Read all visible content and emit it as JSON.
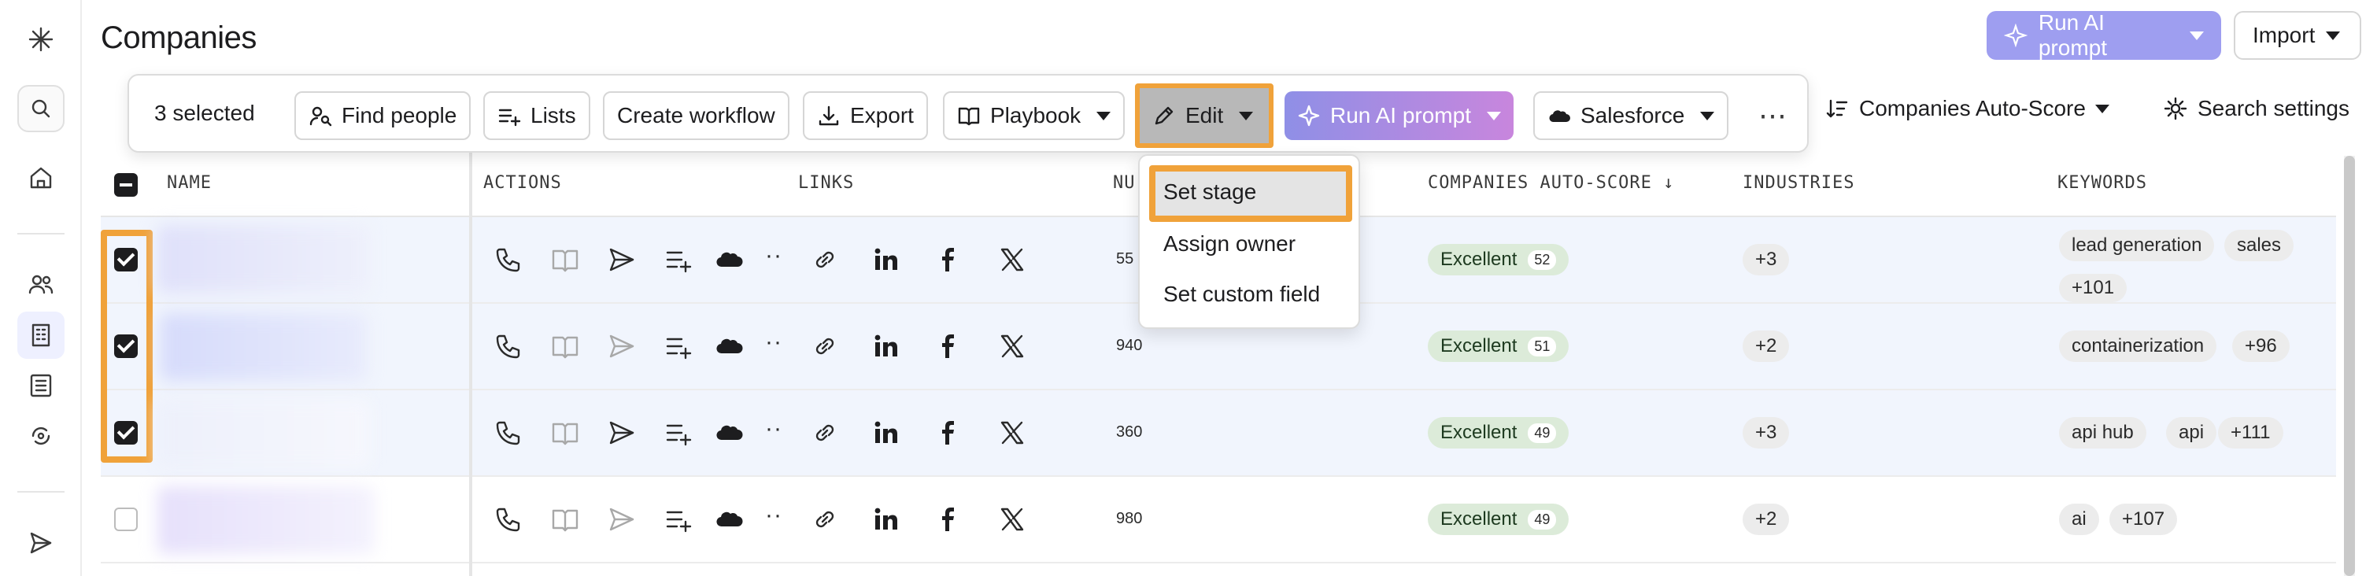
{
  "page": {
    "title": "Companies"
  },
  "header": {
    "ai_label": "Run AI prompt",
    "import_label": "Import"
  },
  "behind": {
    "autoscore_label": "Companies Auto-Score",
    "search_settings_label": "Search settings"
  },
  "toolbar": {
    "selected_text": "3 selected",
    "find_people": "Find people",
    "lists": "Lists",
    "create_workflow": "Create workflow",
    "export": "Export",
    "playbook": "Playbook",
    "edit": "Edit",
    "run_ai": "Run AI prompt",
    "salesforce": "Salesforce",
    "more": "⋯"
  },
  "columns": {
    "name": "NAME",
    "actions": "ACTIONS",
    "links": "LINKS",
    "number_partial": "NU",
    "autoscore": "COMPANIES AUTO-SCORE ↓",
    "industries": "INDUSTRIES",
    "keywords": "KEYWORDS"
  },
  "menu": {
    "items": [
      "Set stage",
      "Assign owner",
      "Set custom field"
    ]
  },
  "rows": [
    {
      "checked": true,
      "num": "55",
      "score_label": "Excellent",
      "score": "52",
      "industries": "+3",
      "keywords": [
        "lead generation",
        "sales",
        "+101"
      ]
    },
    {
      "checked": true,
      "num": "940",
      "score_label": "Excellent",
      "score": "51",
      "industries": "+2",
      "keywords": [
        "containerization",
        "+96"
      ]
    },
    {
      "checked": true,
      "num": "360",
      "score_label": "Excellent",
      "score": "49",
      "industries": "+3",
      "keywords": [
        "api hub",
        "api",
        "+111"
      ]
    },
    {
      "checked": false,
      "num": "980",
      "score_label": "Excellent",
      "score": "49",
      "industries": "+2",
      "keywords": [
        "ai",
        "+107"
      ]
    }
  ],
  "colors": {
    "highlight": "#f0a23a",
    "selected_row": "#f1f5fd",
    "score_pill": "#dcebd9"
  }
}
